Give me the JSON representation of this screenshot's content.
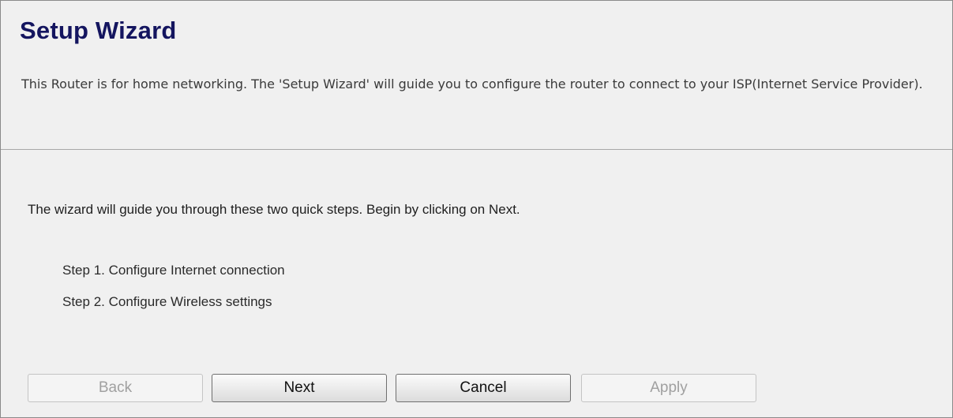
{
  "page": {
    "title": "Setup Wizard",
    "description": "This Router is for home networking. The 'Setup Wizard' will guide you to configure the router to connect to your ISP(Internet Service Provider)."
  },
  "wizard": {
    "intro": "The wizard will guide you through these two quick steps. Begin by clicking on Next.",
    "steps": [
      "Step 1. Configure Internet connection",
      "Step 2. Configure Wireless settings"
    ]
  },
  "buttons": {
    "back": {
      "label": "Back",
      "enabled": false
    },
    "next": {
      "label": "Next",
      "enabled": true
    },
    "cancel": {
      "label": "Cancel",
      "enabled": true
    },
    "apply": {
      "label": "Apply",
      "enabled": false
    }
  },
  "colors": {
    "title": "#14155f",
    "background": "#f0f0f0",
    "disabled_text": "#a0a0a0"
  }
}
